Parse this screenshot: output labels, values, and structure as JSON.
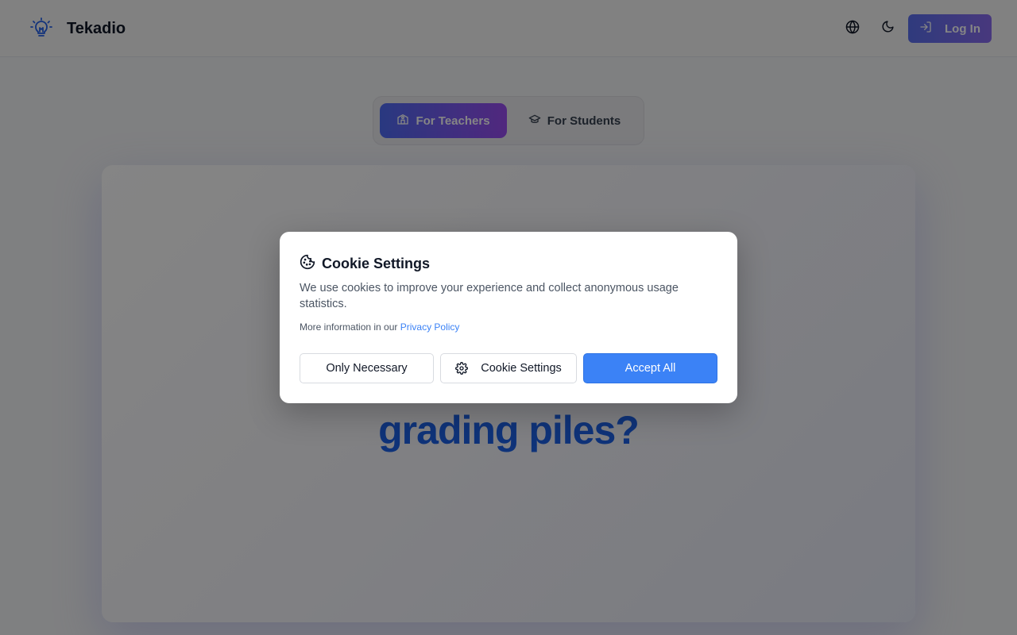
{
  "app": {
    "name": "Tekadio"
  },
  "header": {
    "logo_icon": "lightbulb-icon",
    "language_icon": "globe-icon",
    "theme_icon": "moon-icon",
    "login_label": "Log In",
    "login_icon": "login-arrow-icon"
  },
  "audience_toggle": {
    "teachers_label": "For Teachers",
    "teachers_icon": "school-icon",
    "students_label": "For Students",
    "students_icon": "graduation-cap-icon",
    "selected": "For Teachers"
  },
  "hero": {
    "visible_text": "grading piles?"
  },
  "cookie_dialog": {
    "icon": "cookie-icon",
    "title": "Cookie Settings",
    "description": "We use cookies to improve your experience and collect anonymous usage statistics.",
    "more_prefix": "More information in our ",
    "privacy_link": "Privacy Policy",
    "buttons": {
      "only_necessary": "Only Necessary",
      "settings": "Cookie Settings",
      "accept_all": "Accept All"
    }
  },
  "colors": {
    "primary": "#3b82f6",
    "gradient_start": "#4f6df5",
    "gradient_end": "#9b4df2",
    "hero_text": "#1e63e9"
  }
}
